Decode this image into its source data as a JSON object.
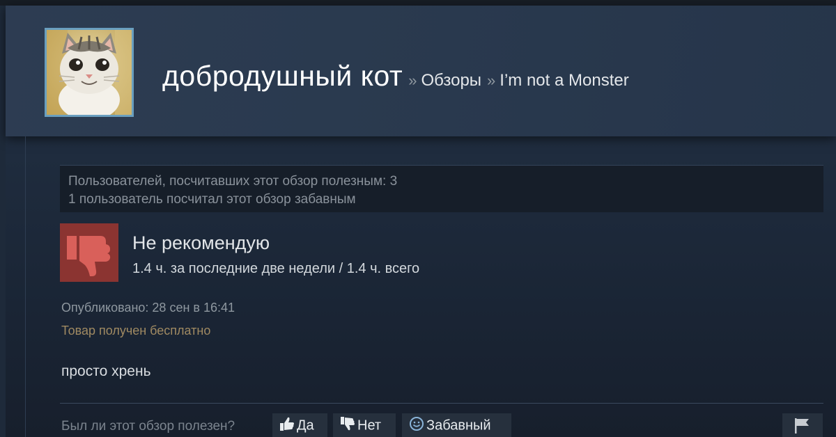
{
  "header": {
    "user_name": "добродушный кот",
    "separator": "»",
    "breadcrumb_reviews": "Обзоры",
    "breadcrumb_game": "I’m not a Monster"
  },
  "helpfulness": {
    "helpful_line": "Пользователей, посчитавших этот обзор полезным: 3",
    "funny_line": "1 пользователь посчитал этот обзор забавным"
  },
  "review": {
    "thumb_icon": "thumbs-down-icon",
    "verdict": "Не рекомендую",
    "hours": "1.4 ч. за последние две недели / 1.4 ч. всего",
    "posted": "Опубликовано: 28 сен в 16:41",
    "free_product": "Товар получен бесплатно",
    "text": "просто хрень"
  },
  "vote": {
    "question": "Был ли этот обзор полезен?",
    "yes_label": "Да",
    "no_label": "Нет",
    "funny_label": "Забавный",
    "yes_icon": "thumbs-up-icon",
    "no_icon": "thumbs-down-icon",
    "funny_icon": "smiley-icon",
    "flag_icon": "flag-icon"
  },
  "colors": {
    "background": "#1b2838",
    "thumb_down_bg": "#8b3431",
    "thumb_down_fg": "#d9605a",
    "free_product_text": "#a08a62"
  }
}
